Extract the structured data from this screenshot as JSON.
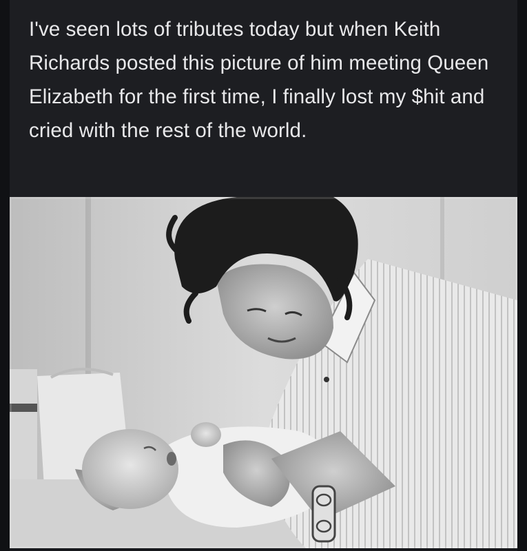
{
  "post": {
    "caption": "I've seen lots of tributes today but when Keith Richards posted this picture of him meeting Queen Elizabeth for the first time, I finally lost my $hit and cried with the rest of the world."
  },
  "photo": {
    "style": "black-and-white",
    "subject": "man-leaning-over-infant"
  },
  "colors": {
    "background": "#17181c",
    "caption_bg": "#1d1e22",
    "text": "#e8e8ea"
  }
}
